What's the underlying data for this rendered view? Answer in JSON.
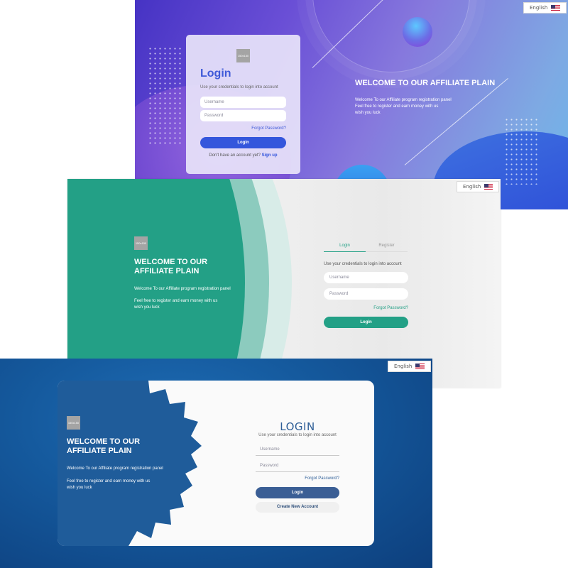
{
  "language": {
    "label": "English",
    "flag_icon": "us-flag-icon"
  },
  "logo_text": "150x150",
  "screen1": {
    "login_title": "Login",
    "subtitle": "Use your credentials to login into account",
    "username_placeholder": "Username",
    "password_placeholder": "Password",
    "forgot_label": "Forgot Password?",
    "login_button": "Login",
    "signup_prompt": "Don't have an account yet?",
    "signup_link": "Sign up",
    "welcome_title": "WELCOME TO OUR AFFILIATE PLAIN",
    "welcome_line1": "Welcome To our Affiliate program registration panel",
    "welcome_line2": "Feel free to register and earn money with us",
    "welcome_line3": "wish you luck",
    "accent": "#3456dc"
  },
  "screen2": {
    "tab_login": "Login",
    "tab_register": "Register",
    "subtitle": "Use your credentials to login into account",
    "username_placeholder": "Username",
    "password_placeholder": "Password",
    "forgot_label": "Forgot Password?",
    "login_button": "Login",
    "welcome_title": "WELCOME TO OUR AFFILIATE PLAIN",
    "welcome_line1": "Welcome To our Affiliate program registration panel",
    "welcome_line2": "Feel free to register and earn money with us",
    "welcome_line3": "wish you luck",
    "accent": "#23a086"
  },
  "screen3": {
    "login_title": "LOGIN",
    "subtitle": "Use your credentials to login into account",
    "username_placeholder": "Username",
    "password_placeholder": "Password",
    "forgot_label": "Forgot Password?",
    "login_button": "Login",
    "create_button": "Create New Account",
    "welcome_title": "WELCOME TO OUR AFFILIATE PLAIN",
    "welcome_line1": "Welcome To our Affiliate program registration panel",
    "welcome_line2": "Feel free to register and earn money with us",
    "welcome_line3": "wish you luck",
    "accent": "#2e5e97"
  }
}
